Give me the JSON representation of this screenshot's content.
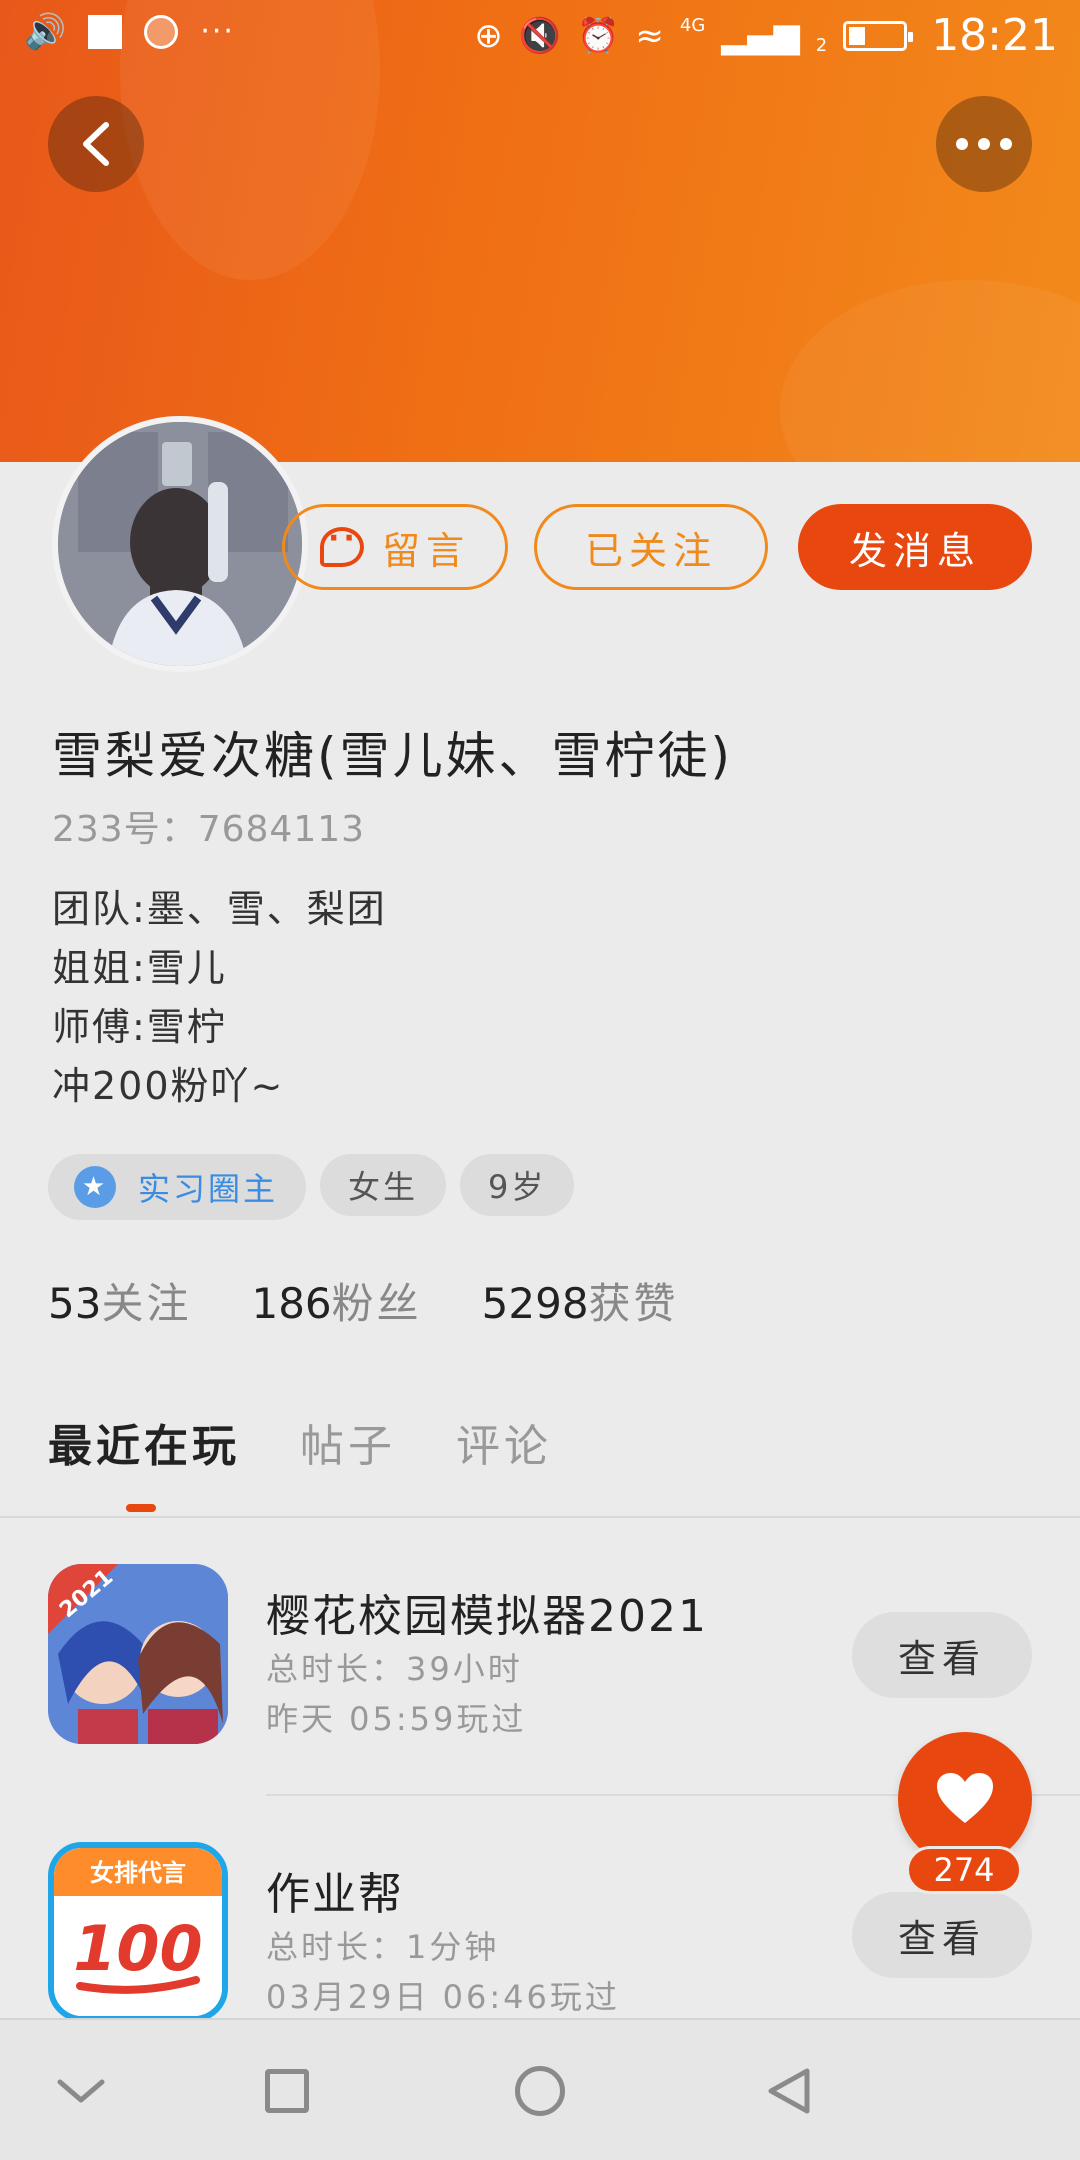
{
  "status_bar": {
    "time": "18:21",
    "network": "4G",
    "sim": "2",
    "overflow": "···"
  },
  "header": {
    "back_icon": "chevron-left-icon",
    "more_icon": "more-dots-icon"
  },
  "profile": {
    "name": "雪梨爱次糖(雪儿妹、雪柠徒)",
    "id_text": "233号：7684113",
    "bio_lines": [
      "团队:墨、雪、梨团",
      "姐姐:雪儿",
      "师傅:雪柠",
      "冲200粉吖~"
    ]
  },
  "actions": {
    "comment_label": "留言",
    "followed_label": "已关注",
    "message_label": "发消息"
  },
  "tags": {
    "role": "实习圈主",
    "gender": "女生",
    "age": "9岁"
  },
  "stats": {
    "following_count": "53",
    "following_label": "关注",
    "fans_count": "186",
    "fans_label": "粉丝",
    "likes_count": "5298",
    "likes_label": "获赞"
  },
  "tabs": [
    {
      "label": "最近在玩",
      "active": true
    },
    {
      "label": "帖子",
      "active": false
    },
    {
      "label": "评论",
      "active": false
    }
  ],
  "games": [
    {
      "title": "樱花校园模拟器2021",
      "total_time": "总时长：39小时",
      "last_played": "昨天 05:59玩过",
      "view_label": "查看",
      "icon_badge": "2021"
    },
    {
      "title": "作业帮",
      "total_time": "总时长：1分钟",
      "last_played": "03月29日 06:46玩过",
      "view_label": "查看",
      "icon_banner": "女排代言",
      "icon_number": "100"
    }
  ],
  "like_fab": {
    "count": "274",
    "icon": "heart-icon"
  },
  "colors": {
    "accent": "#e8470f",
    "banner_start": "#e8581a",
    "banner_end": "#f28a1b",
    "outline": "#f08a1c",
    "role_blue": "#3a8ce0"
  }
}
